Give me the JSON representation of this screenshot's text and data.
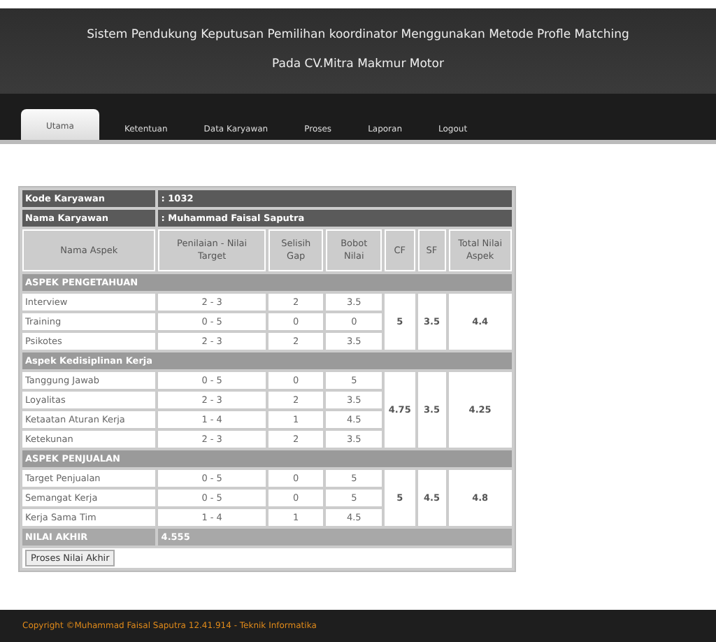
{
  "header": {
    "title_lines": [
      "Sistem Pendukung Keputusan Pemilihan koordinator Menggunakan Metode Profle Matching",
      "Pada CV.Mitra Makmur Motor"
    ]
  },
  "tabs": [
    {
      "label": "Utama",
      "selected": true
    },
    {
      "label": "Ketentuan",
      "selected": false
    },
    {
      "label": "Data Karyawan",
      "selected": false
    },
    {
      "label": "Proses",
      "selected": false
    },
    {
      "label": "Laporan",
      "selected": false
    },
    {
      "label": "Logout",
      "selected": false
    }
  ],
  "employee": [
    {
      "label": "Kode Karyawan",
      "value": ": 1032"
    },
    {
      "label": "Nama Karyawan",
      "value": ": Muhammad Faisal Saputra"
    }
  ],
  "table": {
    "columns": [
      "Nama Aspek",
      "Penilaian - Nilai Target",
      "Selisih Gap",
      "Bobot Nilai",
      "CF",
      "SF",
      "Total Nilai Aspek"
    ],
    "groups": [
      {
        "name": "ASPEK PENGETAHUAN",
        "cf": "5",
        "sf": "3.5",
        "total": "4.4",
        "rows": [
          {
            "aspect": "Interview",
            "range": "2 - 3",
            "gap": "2",
            "weight": "3.5"
          },
          {
            "aspect": "Training",
            "range": "0 - 5",
            "gap": "0",
            "weight": "0"
          },
          {
            "aspect": "Psikotes",
            "range": "2 - 3",
            "gap": "2",
            "weight": "3.5"
          }
        ]
      },
      {
        "name": "Aspek Kedisiplinan Kerja",
        "cf": "4.75",
        "sf": "3.5",
        "total": "4.25",
        "rows": [
          {
            "aspect": "Tanggung Jawab",
            "range": "0 - 5",
            "gap": "0",
            "weight": "5"
          },
          {
            "aspect": "Loyalitas",
            "range": "2 - 3",
            "gap": "2",
            "weight": "3.5"
          },
          {
            "aspect": "Ketaatan Aturan Kerja",
            "range": "1 - 4",
            "gap": "1",
            "weight": "4.5"
          },
          {
            "aspect": "Ketekunan",
            "range": "2 - 3",
            "gap": "2",
            "weight": "3.5"
          }
        ]
      },
      {
        "name": "ASPEK PENJUALAN",
        "cf": "5",
        "sf": "4.5",
        "total": "4.8",
        "rows": [
          {
            "aspect": "Target Penjualan",
            "range": "0 - 5",
            "gap": "0",
            "weight": "5"
          },
          {
            "aspect": "Semangat Kerja",
            "range": "0 - 5",
            "gap": "0",
            "weight": "5"
          },
          {
            "aspect": "Kerja Sama Tim",
            "range": "1 - 4",
            "gap": "1",
            "weight": "4.5"
          }
        ]
      }
    ]
  },
  "final": {
    "label": "NILAI AKHIR",
    "value": "4.555"
  },
  "button": "Proses Nilai Akhir",
  "footer": "Copyright ©Muhammad Faisal Saputra 12.41.914 - Teknik Informatika"
}
